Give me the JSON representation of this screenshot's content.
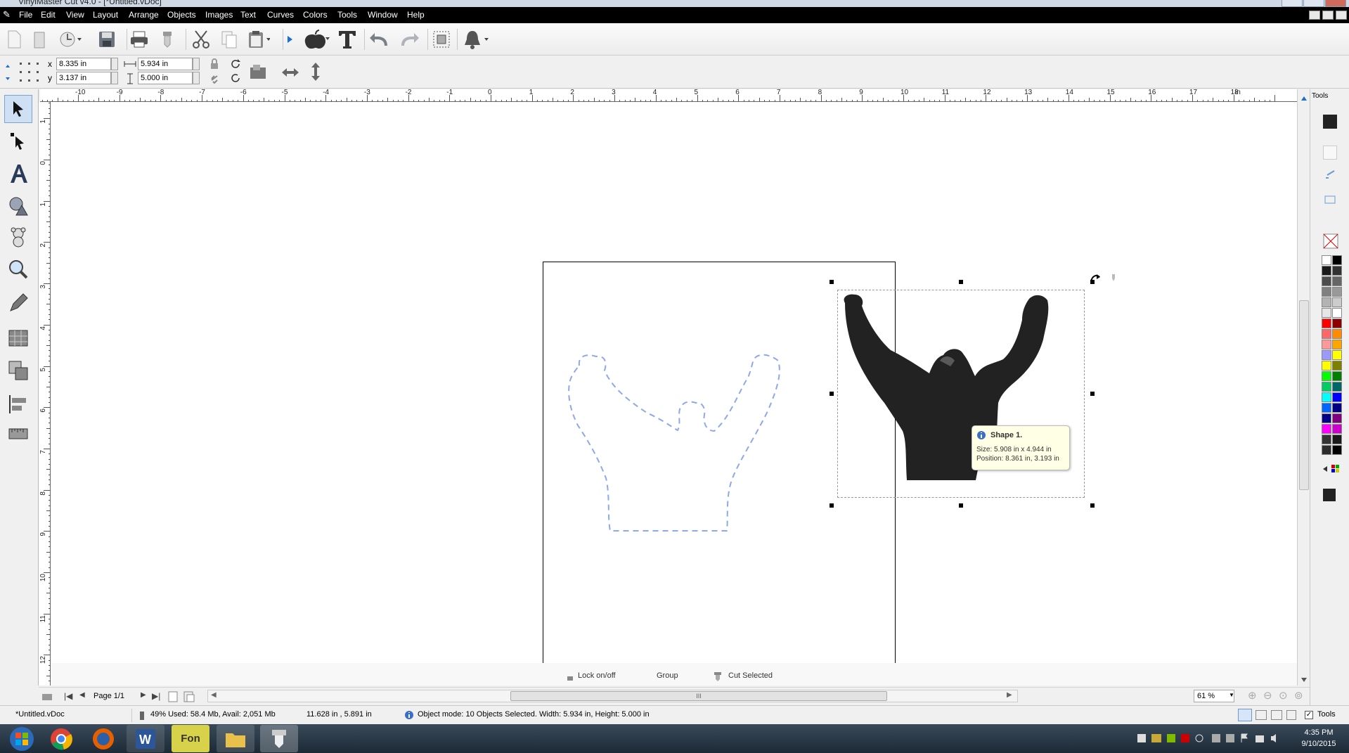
{
  "window": {
    "title": "VinylMaster Cut v4.0 - [*Untitled.vDoc]"
  },
  "menu": [
    "File",
    "Edit",
    "View",
    "Layout",
    "Arrange",
    "Objects",
    "Images",
    "Text",
    "Curves",
    "Colors",
    "Tools",
    "Window",
    "Help"
  ],
  "toolbar_icons": [
    "new-file-icon",
    "open-file-icon",
    "recent-icon",
    "save-icon",
    "print-icon",
    "cut-device-icon",
    "cut-icon",
    "copy-icon",
    "paste-icon",
    "play-icon",
    "apple-icon",
    "text-t-icon",
    "undo-icon",
    "redo-icon",
    "select-all-icon",
    "bell-icon"
  ],
  "properties": {
    "x_label": "x",
    "x_value": "8.335 in",
    "y_label": "y",
    "y_value": "3.137 in",
    "width_value": "5.934 in",
    "height_value": "5.000 in"
  },
  "left_tools": [
    "select-tool-icon",
    "node-edit-tool-icon",
    "text-tool-icon",
    "shape-tool-icon",
    "clipart-tool-icon",
    "zoom-tool-icon",
    "pen-tool-icon",
    "fill-tool-icon",
    "weld-tool-icon",
    "align-tool-icon",
    "measure-tool-icon"
  ],
  "ruler": {
    "h_labels": [
      "-10",
      "-9",
      "-8",
      "-7",
      "-6",
      "-5",
      "-4",
      "-3",
      "-2",
      "-1",
      "0",
      "1",
      "2",
      "3",
      "4",
      "5",
      "6",
      "7",
      "8",
      "9",
      "10",
      "11",
      "12",
      "13",
      "14",
      "15",
      "16",
      "17",
      "18",
      "in"
    ],
    "v_labels": [
      "1",
      "0",
      "1",
      "2",
      "3",
      "4",
      "5",
      "6",
      "7",
      "8",
      "9",
      "10",
      "11",
      "12"
    ]
  },
  "right_panel": {
    "tab_label": "Tools",
    "palette": [
      "#ffffff",
      "#000000",
      "#1a1a1a",
      "#333333",
      "#4d4d4d",
      "#666666",
      "#808080",
      "#999999",
      "#b3b3b3",
      "#cccccc",
      "#e6e6e6",
      "#ffffff",
      "#ff0000",
      "#8b0000",
      "#ff6666",
      "#ff8c00",
      "#ff9999",
      "#ffa500",
      "#9999ff",
      "#ffff00",
      "#ffff00",
      "#808000",
      "#00ff00",
      "#008000",
      "#00cc66",
      "#006666",
      "#00ffff",
      "#0000ff",
      "#0066ff",
      "#000080",
      "#00008b",
      "#800080",
      "#ff00ff",
      "#cc00cc",
      "#333333",
      "#1a1a1a",
      "#2b2b2b",
      "#000000"
    ]
  },
  "tooltip": {
    "title": "Shape 1.",
    "size": "Size: 5.908 in x 4.944 in",
    "position": "Position: 8.361 in, 3.193 in"
  },
  "bottom_actions": {
    "lock": "Lock on/off",
    "group": "Group",
    "cut_selected": "Cut Selected"
  },
  "nav": {
    "page": "Page 1/1",
    "zoom": "61 %",
    "scroll_grip": "III"
  },
  "status": {
    "file": "*Untitled.vDoc",
    "memory": "49%  Used: 58.4 Mb, Avail: 2,051 Mb",
    "cursor": "11.628 in , 5.891 in",
    "mode": "Object mode: 10 Objects Selected.  Width: 5.934 in, Height: 5.000 in",
    "tools_label": "Tools"
  },
  "taskbar": {
    "apps": [
      "start-icon",
      "chrome-icon",
      "firefox-icon",
      "word-icon",
      "font-app-icon",
      "explorer-icon",
      "vinylmaster-icon"
    ],
    "font_app_label": "Fon",
    "time": "4:35 PM",
    "date": "9/10/2015"
  },
  "colors": {
    "accent": "#0a64c8",
    "outline": "#8fa8e8",
    "silhouette": "#222222"
  }
}
